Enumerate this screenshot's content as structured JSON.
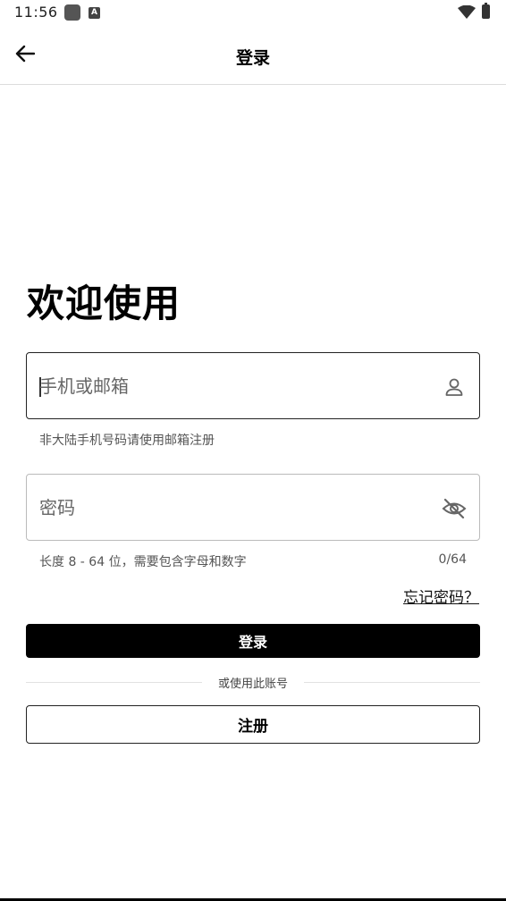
{
  "status_bar": {
    "time": "11:56",
    "icons": [
      "app-icon",
      "a-icon",
      "wifi-icon",
      "battery-icon"
    ]
  },
  "header": {
    "title": "登录",
    "back_icon": "arrow-left-icon"
  },
  "welcome": {
    "heading": "欢迎使用"
  },
  "phone_field": {
    "placeholder": "手机或邮箱",
    "value": "",
    "icon": "person-icon",
    "helper": "非大陆手机号码请使用邮箱注册"
  },
  "password_field": {
    "placeholder": "密码",
    "value": "",
    "icon": "eye-off-icon",
    "helper": "长度 8 - 64 位，需要包含字母和数字",
    "counter": "0/64"
  },
  "forgot_password": "忘记密码？",
  "login_button": "登录",
  "divider_text": "或使用此账号",
  "register_button": "注册",
  "colors": {
    "primary": "#000000",
    "background": "#ffffff",
    "border_active": "#222222",
    "border_inactive": "#bbbbbb",
    "helper_text": "#555555"
  }
}
